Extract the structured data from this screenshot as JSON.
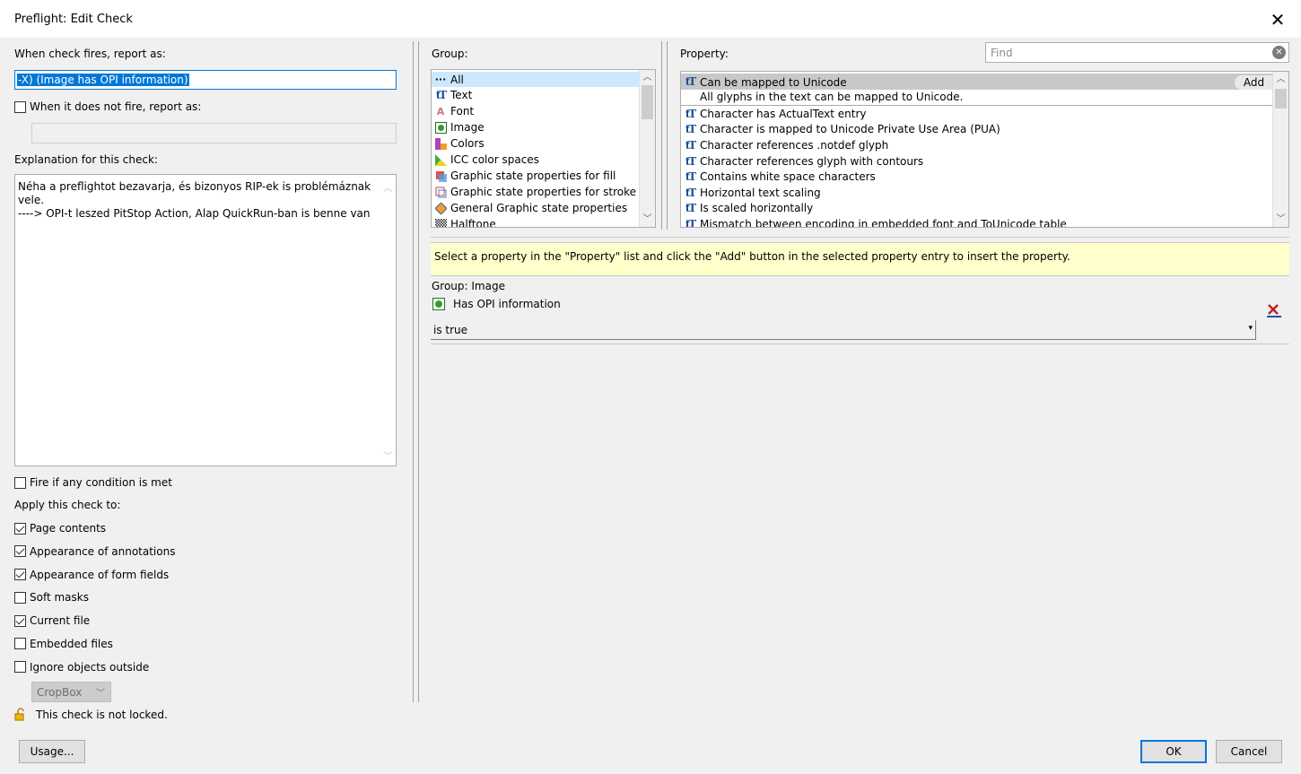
{
  "window": {
    "title": "Preflight: Edit Check",
    "close_icon": "close-icon"
  },
  "left": {
    "report_label": "When check fires, report as:",
    "report_value": "-X) (Image has OPI information)",
    "not_fire_label": "When it does not fire, report as:",
    "not_fire_value": "",
    "explanation_label": "Explanation for this check:",
    "explanation_line1": "Néha a preflightot bezavarja, és bizonyos RIP-ek is problémáznak vele.",
    "explanation_line2": "----> OPI-t leszed PitStop Action, Alap QuickRun-ban is benne van",
    "fire_any_label": "Fire if any condition is met",
    "apply_label": "Apply this check to:",
    "apply_items": [
      {
        "label": "Page contents",
        "checked": true
      },
      {
        "label": "Appearance of annotations",
        "checked": true
      },
      {
        "label": "Appearance of form fields",
        "checked": true
      },
      {
        "label": "Soft masks",
        "checked": false
      },
      {
        "label": "Current file",
        "checked": true
      },
      {
        "label": "Embedded files",
        "checked": false
      },
      {
        "label": "Ignore objects outside",
        "checked": false
      }
    ],
    "cropbox_value": "CropBox",
    "lock_text": "This check is not locked.",
    "usage_button": "Usage..."
  },
  "group": {
    "label": "Group:",
    "items": [
      {
        "label": "All",
        "icon": "ellipsis-icon"
      },
      {
        "label": "Text",
        "icon": "text-tt-icon"
      },
      {
        "label": "Font",
        "icon": "font-icon"
      },
      {
        "label": "Image",
        "icon": "image-icon"
      },
      {
        "label": "Colors",
        "icon": "colors-icon"
      },
      {
        "label": "ICC color spaces",
        "icon": "icc-icon"
      },
      {
        "label": "Graphic state properties for fill",
        "icon": "fill-icon"
      },
      {
        "label": "Graphic state properties for stroke",
        "icon": "stroke-icon"
      },
      {
        "label": "General Graphic state properties",
        "icon": "graphic-state-icon"
      },
      {
        "label": "Halftone",
        "icon": "halftone-icon"
      }
    ]
  },
  "property": {
    "label": "Property:",
    "find_placeholder": "Find",
    "selected_title": "Can be mapped to Unicode",
    "selected_desc": "All glyphs in the text can be mapped to Unicode.",
    "add_button": "Add",
    "items": [
      "Character has ActualText entry",
      "Character is mapped to Unicode Private Use Area (PUA)",
      "Character references .notdef glyph",
      "Character references glyph with contours",
      "Contains white space characters",
      "Horizontal text scaling",
      "Is scaled horizontally",
      "Mismatch between encoding in embedded font and ToUnicode table"
    ]
  },
  "hint": "Select a property in the \"Property\" list and click the \"Add\" button in the selected property entry to insert the property.",
  "condition": {
    "group_text": "Group: Image",
    "property_text": "Has OPI information",
    "value": "is true"
  },
  "footer": {
    "ok": "OK",
    "cancel": "Cancel"
  },
  "colors": {
    "accent": "#0078d7",
    "hint_bg": "#ffffcc",
    "selection": "#cce8ff"
  }
}
